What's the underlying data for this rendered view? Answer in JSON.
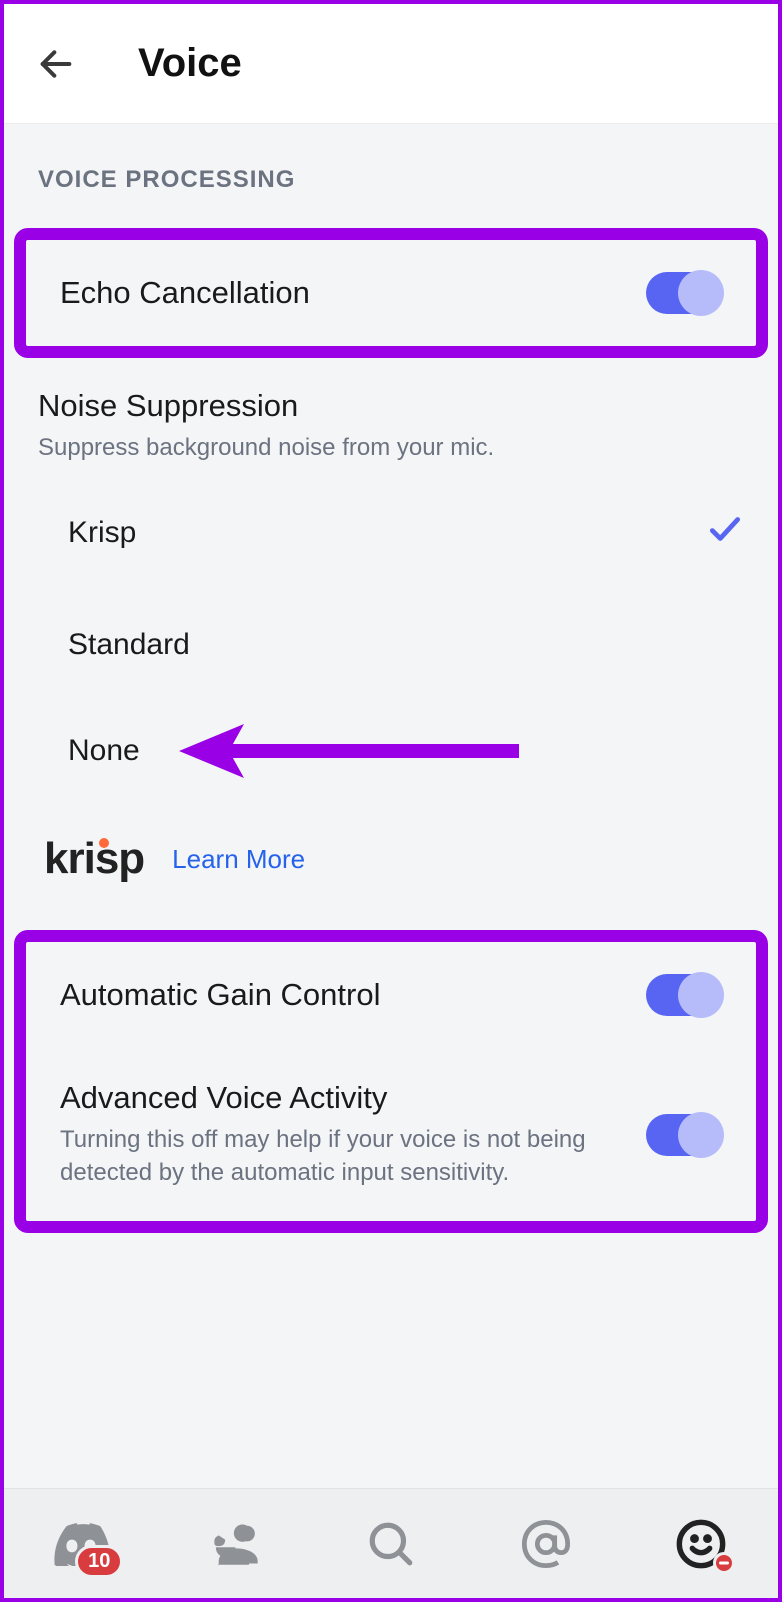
{
  "header": {
    "title": "Voice"
  },
  "section": {
    "title": "VOICE PROCESSING"
  },
  "echo": {
    "label": "Echo Cancellation",
    "on": true
  },
  "noise": {
    "label": "Noise Suppression",
    "sub": "Suppress background noise from your mic.",
    "options": {
      "krisp": "Krisp",
      "standard": "Standard",
      "none": "None"
    },
    "selected": "krisp",
    "learn_more": "Learn More",
    "logo_text": "krisp"
  },
  "agc": {
    "label": "Automatic Gain Control",
    "on": true
  },
  "adv": {
    "label": "Advanced Voice Activity",
    "sub": "Turning this off may help if your voice is not being detected by the automatic input sensitivity.",
    "on": true
  },
  "nav": {
    "badge": "10"
  }
}
